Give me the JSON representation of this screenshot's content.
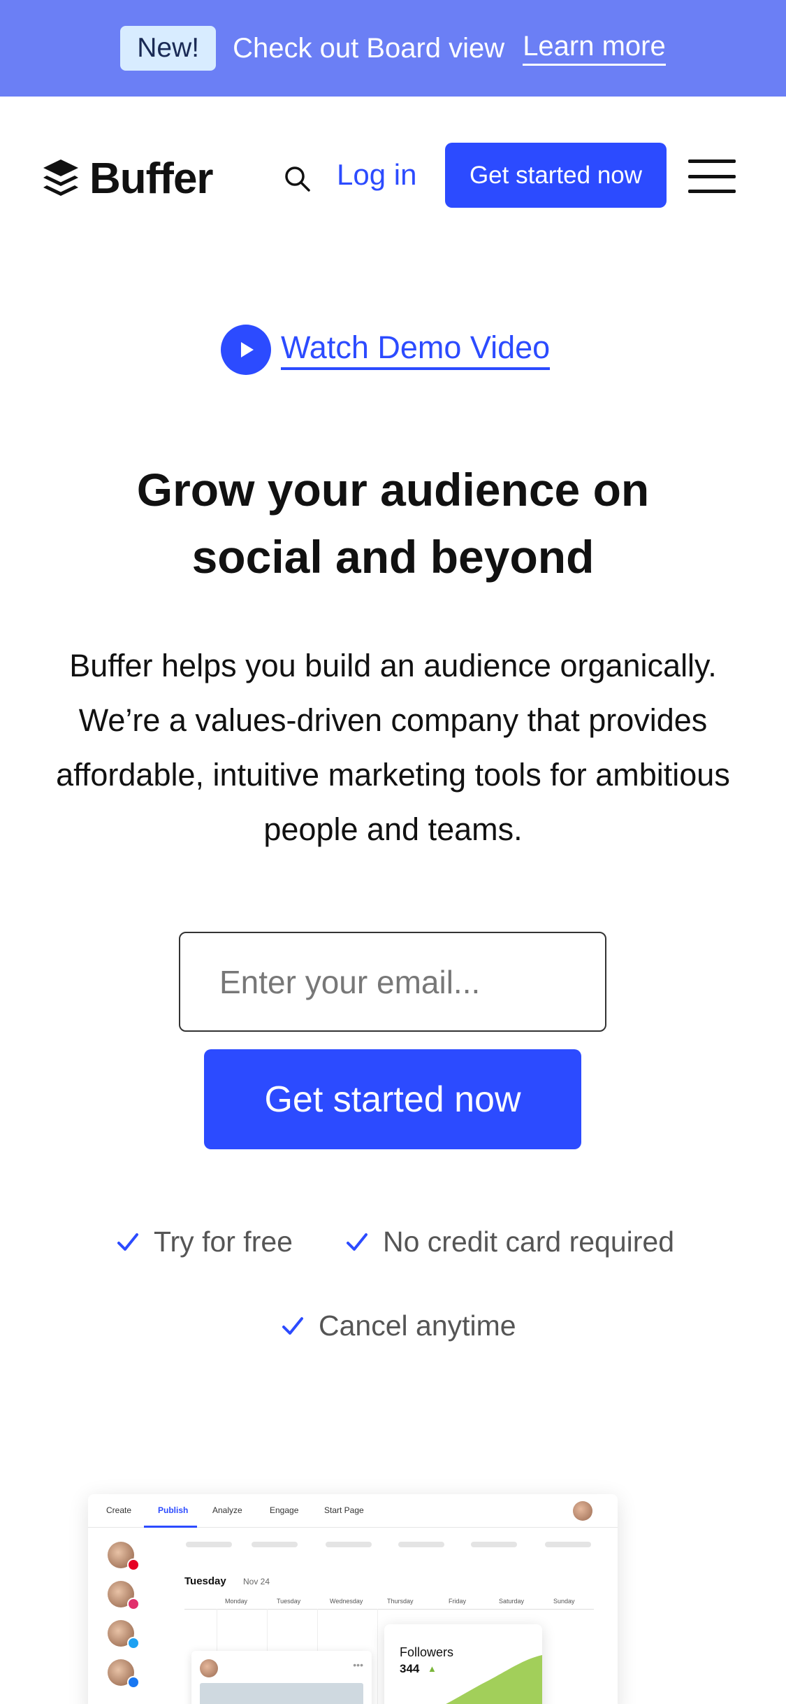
{
  "announcement": {
    "badge": "New!",
    "text": "Check out Board view",
    "link": "Learn more"
  },
  "header": {
    "logo_text": "Buffer",
    "login": "Log in",
    "cta": "Get started now"
  },
  "hero": {
    "demo_link": "Watch Demo Video",
    "headline_line1": "Grow your audience on",
    "headline_line2": "social and beyond",
    "subtext": "Buffer helps you build an audience organically. We’re a values-driven company that provides affordable, intuitive marketing tools for ambitious people and teams.",
    "email_placeholder": "Enter your email...",
    "cta": "Get started now",
    "perks": [
      "Try for free",
      "No credit card required",
      "Cancel anytime"
    ]
  },
  "product_preview": {
    "tabs": [
      "Create",
      "Publish",
      "Analyze",
      "Engage",
      "Start Page"
    ],
    "active_tab": "Publish",
    "day": "Tuesday",
    "date": "Nov 24",
    "weekdays": [
      "Monday",
      "Tuesday",
      "Wednesday",
      "Thursday",
      "Friday",
      "Saturday",
      "Sunday"
    ],
    "followers_label": "Followers",
    "followers_count": "344",
    "followers_trend": "▲"
  },
  "colors": {
    "brand_blue": "#2c4bff",
    "announcement_bg": "#6b7ff5",
    "badge_bg": "#d8ecff"
  }
}
